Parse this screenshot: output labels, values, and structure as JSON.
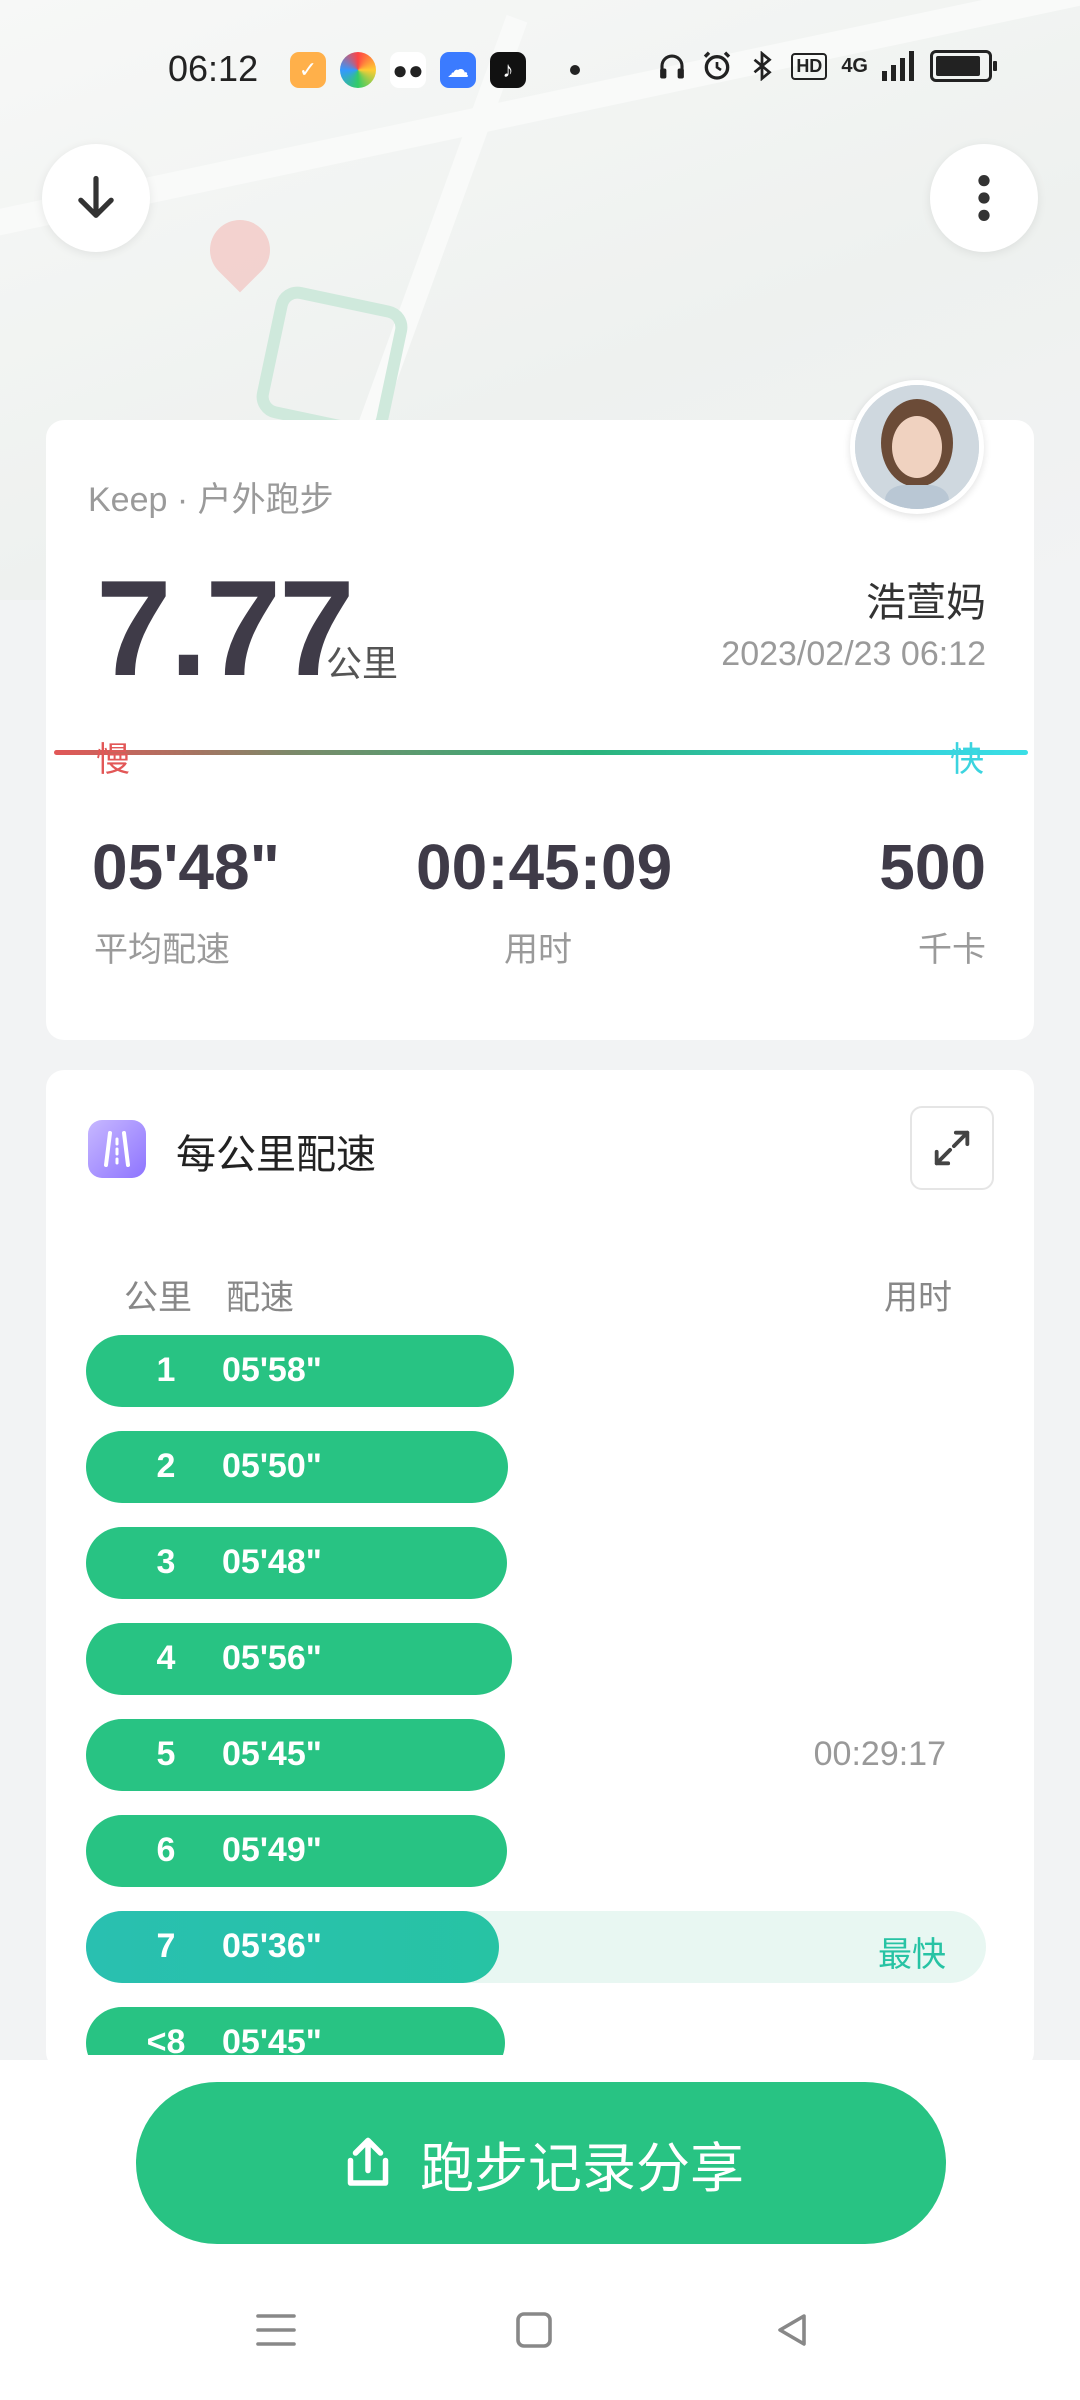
{
  "status_bar": {
    "time": "06:12",
    "app_icons": [
      "keep-icon",
      "pinwheel-icon",
      "wechat-icon",
      "cloud-icon",
      "tiktok-icon"
    ],
    "indicators": [
      "headphones-icon",
      "alarm-icon",
      "bluetooth-icon",
      "HD",
      "4G",
      "signal-icon",
      "battery-icon"
    ],
    "hd_label": "HD",
    "net_label": "4G"
  },
  "summary": {
    "brand": "Keep · 户外跑步",
    "distance": "7.77",
    "distance_unit": "公里",
    "user_name": "浩萱妈",
    "datetime": "2023/02/23 06:12",
    "slow_label": "慢",
    "fast_label": "快",
    "stats": [
      {
        "value": "05'48\"",
        "label": "平均配速"
      },
      {
        "value": "00:45:09",
        "label": "用时"
      },
      {
        "value": "500",
        "label": "千卡"
      }
    ]
  },
  "pace_section": {
    "title": "每公里配速",
    "col_km": "公里",
    "col_pace": "配速",
    "col_time": "用时",
    "rows": [
      {
        "km": "1",
        "pace": "05'58\"",
        "fill": 0.475
      },
      {
        "km": "2",
        "pace": "05'50\"",
        "fill": 0.469
      },
      {
        "km": "3",
        "pace": "05'48\"",
        "fill": 0.468
      },
      {
        "km": "4",
        "pace": "05'56\"",
        "fill": 0.473
      },
      {
        "km": "5",
        "pace": "05'45\"",
        "fill": 0.466,
        "time": "00:29:17"
      },
      {
        "km": "6",
        "pace": "05'49\"",
        "fill": 0.468
      },
      {
        "km": "7",
        "pace": "05'36\"",
        "fill": 0.459,
        "tag": "最快",
        "best": true
      },
      {
        "km": "<8",
        "pace": "05'45\"",
        "fill": 0.466
      }
    ]
  },
  "share_button": {
    "label": "跑步记录分享"
  },
  "colors": {
    "accent": "#28c383",
    "best": "#27c3a4",
    "slow": "#e25757",
    "fast": "#3bd4df"
  }
}
